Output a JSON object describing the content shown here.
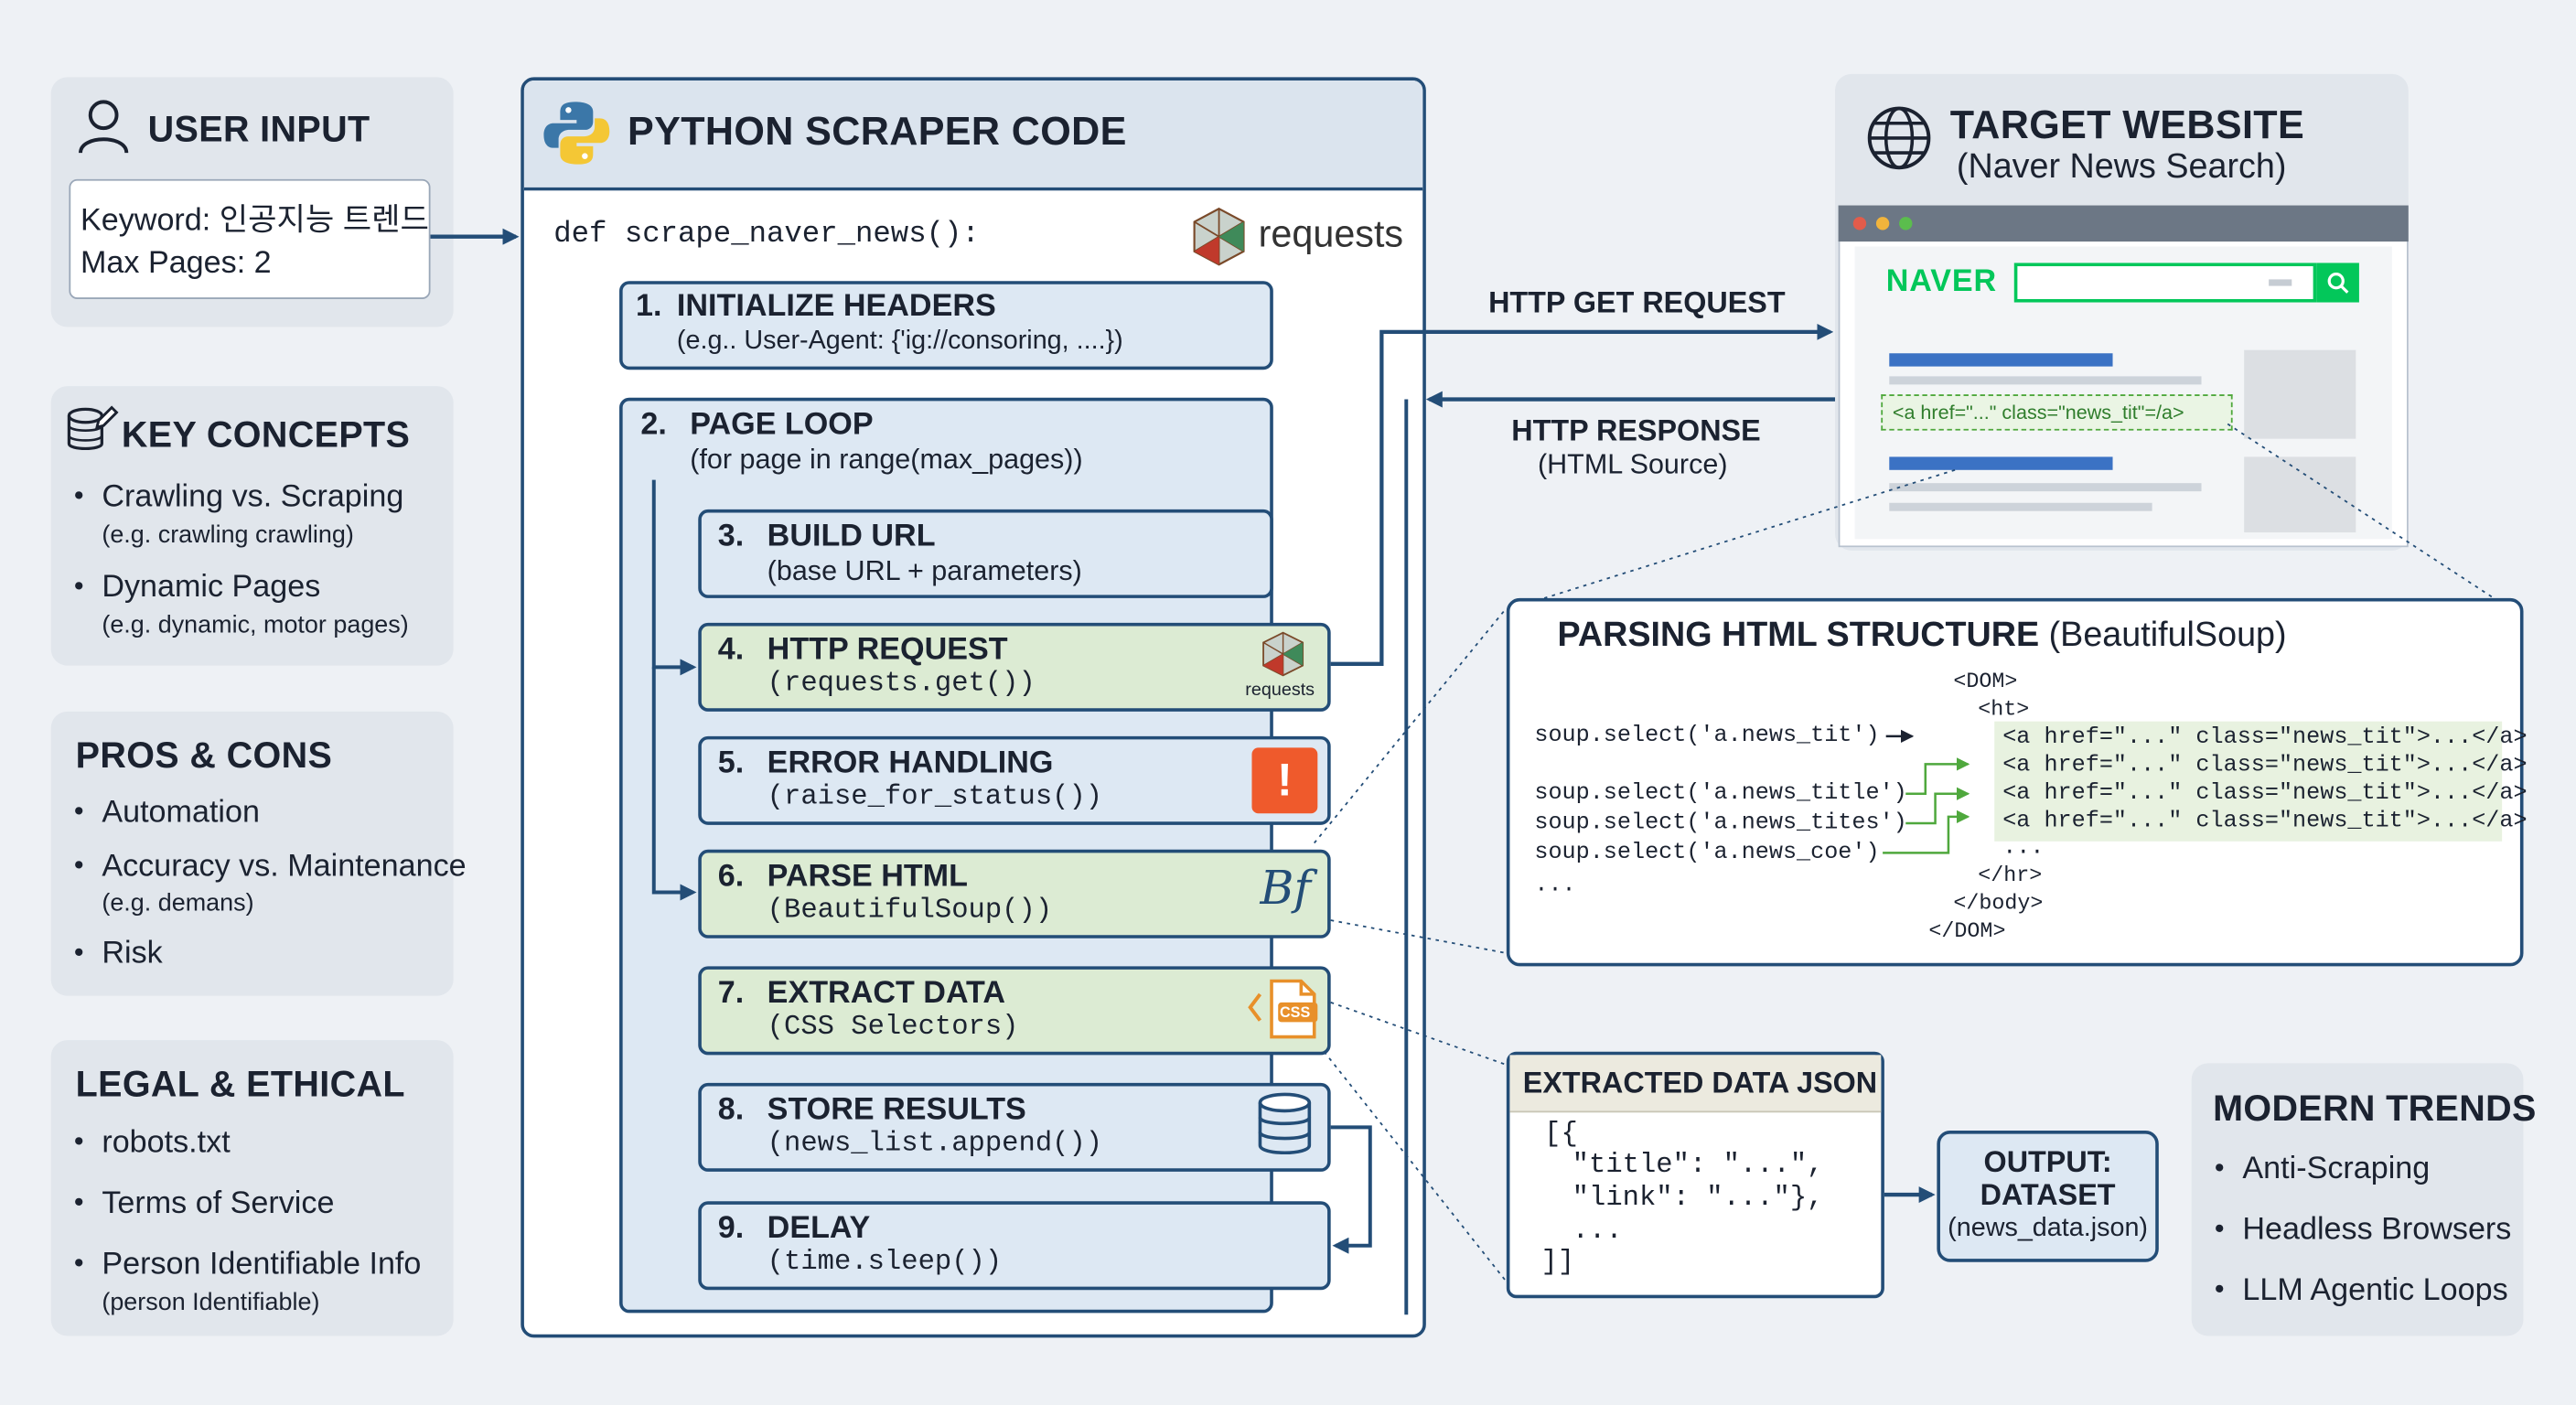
{
  "colors": {
    "background": "#eef1f5",
    "card": "#e1e6ec",
    "navy": "#234d77",
    "step_blue": "#dde8f3",
    "step_green": "#dcebd3",
    "naver_green": "#03c75a",
    "error_red": "#ef5a2c",
    "css_orange": "#e8902a"
  },
  "user_input": {
    "title": "USER INPUT",
    "icon": "user-icon",
    "keyword": "Keyword: 인공지능 트렌드",
    "max_pages": "Max Pages: 2"
  },
  "key_concepts": {
    "title": "KEY CONCEPTS",
    "icon": "database-edit-icon",
    "items": [
      {
        "label": "Crawling vs. Scraping",
        "note": "(e.g. crawling crawling)"
      },
      {
        "label": "Dynamic Pages",
        "note": "(e.g. dynamic, motor pages)"
      }
    ]
  },
  "pros_cons": {
    "title": "PROS & CONS",
    "items": [
      {
        "label": "Automation",
        "note": ""
      },
      {
        "label": "Accuracy vs. Maintenance",
        "note": "(e.g. demans)"
      },
      {
        "label": "Risk",
        "note": ""
      }
    ]
  },
  "legal": {
    "title": "LEGAL & ETHICAL",
    "items": [
      {
        "label": "robots.txt",
        "note": ""
      },
      {
        "label": "Terms of Service",
        "note": ""
      },
      {
        "label": "Person Identifiable Info",
        "note": "(person Identifiable)"
      }
    ]
  },
  "scraper": {
    "title": "PYTHON SCRAPER CODE",
    "icon": "python-logo-icon",
    "def_line": "def scrape_naver_news():",
    "library": "requests",
    "steps": [
      {
        "num": "1.",
        "title": "INITIALIZE HEADERS",
        "sub": "(e.g.. User-Agent: {'ig://consoring, ....})"
      },
      {
        "num": "2.",
        "title": "PAGE LOOP",
        "sub": "(for page in range(max_pages))"
      },
      {
        "num": "3.",
        "title": "BUILD URL",
        "sub": "(base URL + parameters)"
      },
      {
        "num": "4.",
        "title": "HTTP REQUEST",
        "sub": "(requests.get())",
        "badge": "requests"
      },
      {
        "num": "5.",
        "title": "ERROR HANDLING",
        "sub": "(raise_for_status())",
        "badge": "!"
      },
      {
        "num": "6.",
        "title": "PARSE HTML",
        "sub": "(BeautifulSoup())",
        "badge": "Bf"
      },
      {
        "num": "7.",
        "title": "EXTRACT DATA",
        "sub": "(CSS Selectors)",
        "badge": "CSS"
      },
      {
        "num": "8.",
        "title": "STORE RESULTS",
        "sub": "(news_list.append())"
      },
      {
        "num": "9.",
        "title": "DELAY",
        "sub": "(time.sleep())"
      }
    ]
  },
  "target": {
    "title": "TARGET WEBSITE",
    "subtitle": "(Naver News Search)",
    "icon": "globe-icon",
    "brand": "NAVER",
    "highlight": "<a href=\"...\" class=\"news_tit\"=/a>"
  },
  "http": {
    "request": "HTTP GET REQUEST",
    "response": "HTTP RESPONSE",
    "response_sub": "(HTML Source)"
  },
  "parsing": {
    "title_bold": "PARSING HTML STRUCTURE",
    "title_rest": " (BeautifulSoup)",
    "selectors": [
      "soup.select('a.news_tit')",
      "soup.select('a.news_title')",
      "soup.select('a.news_tites')",
      "soup.select('a.news_coe')",
      "..."
    ],
    "dom_lines": [
      "<DOM>",
      "<ht>",
      "<a href=\"...\" class=\"news_tit\">...</a>",
      "<a href=\"...\" class=\"news_tit\">...</a>",
      "<a href=\"...\" class=\"news_tit\">...</a>",
      "<a href=\"...\" class=\"news_tit\">...</a>",
      "...",
      "</hr>",
      "</body>",
      "</DOM>"
    ]
  },
  "extracted": {
    "title": "EXTRACTED DATA JSON",
    "lines": [
      "[{",
      "\"title\": \"...\",",
      "\"link\": \"...\"},",
      "...",
      "]]"
    ]
  },
  "output": {
    "line1": "OUTPUT:",
    "line2": "DATASET",
    "line3": "(news_data.json)"
  },
  "modern": {
    "title": "MODERN TRENDS",
    "items": [
      "Anti-Scraping",
      "Headless Browsers",
      "LLM Agentic Loops"
    ]
  }
}
